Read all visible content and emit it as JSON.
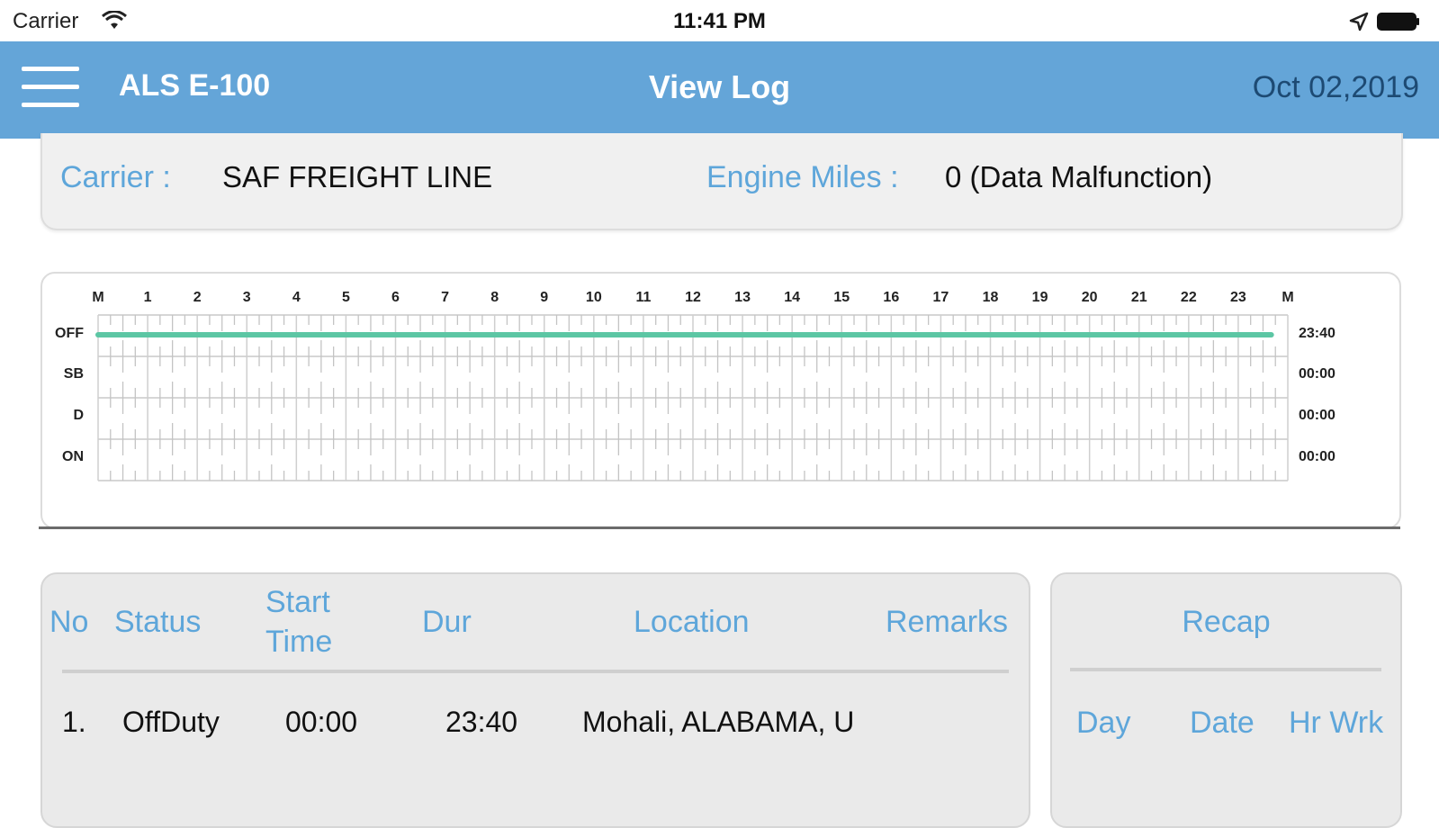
{
  "status_bar": {
    "carrier": "Carrier",
    "time": "11:41 PM"
  },
  "nav": {
    "device": "ALS E-100",
    "title": "View Log",
    "date": "Oct 02,2019"
  },
  "carrier_info": {
    "carrier_label": "Carrier :",
    "carrier_value": "SAF FREIGHT LINE",
    "engine_miles_label": "Engine Miles :",
    "engine_miles_value": "0 (Data Malfunction)"
  },
  "chart_data": {
    "type": "line",
    "hour_labels": [
      "M",
      "1",
      "2",
      "3",
      "4",
      "5",
      "6",
      "7",
      "8",
      "9",
      "10",
      "11",
      "12",
      "13",
      "14",
      "15",
      "16",
      "17",
      "18",
      "19",
      "20",
      "21",
      "22",
      "23",
      "M"
    ],
    "rows": [
      "OFF",
      "SB",
      "D",
      "ON"
    ],
    "totals": [
      "23:40",
      "00:00",
      "00:00",
      "00:00"
    ],
    "series": [
      {
        "status": "OFF",
        "start_hour": 0,
        "end_hour": 23.667
      }
    ],
    "x_range": [
      0,
      24
    ],
    "line_color": "#5cc6a4"
  },
  "log_table": {
    "headers": {
      "no": "No",
      "status": "Status",
      "start_time_1": "Start",
      "start_time_2": "Time",
      "dur": "Dur",
      "location": "Location",
      "remarks": "Remarks"
    },
    "rows": [
      {
        "no": "1.",
        "status": "OffDuty",
        "start": "00:00",
        "dur": "23:40",
        "location": "Mohali, ALABAMA, U",
        "remarks": ""
      }
    ]
  },
  "recap": {
    "title": "Recap",
    "headers": {
      "day": "Day",
      "date": "Date",
      "hr_wrk": "Hr Wrk"
    }
  },
  "colors": {
    "nav_bg": "#64a5d8",
    "accent_blue": "#5ea6da",
    "date_text": "#1d4a73"
  }
}
